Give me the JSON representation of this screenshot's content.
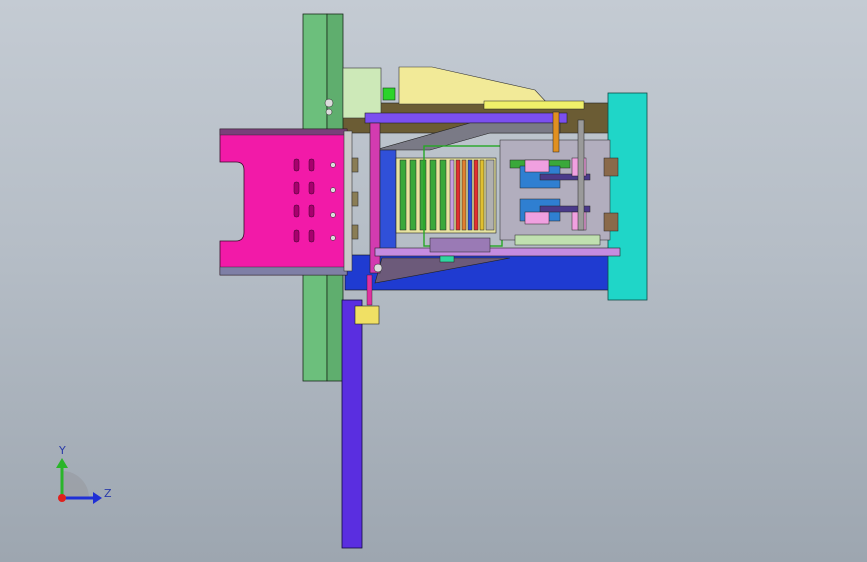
{
  "viewport": {
    "background_top": "#c4cbd3",
    "background_bottom": "#9da6b0"
  },
  "triad": {
    "y_label": "Y",
    "z_label": "Z",
    "x_color": "#e0201c",
    "y_color": "#2ab52a",
    "z_color": "#1f2fd6"
  },
  "model": {
    "name_icon": "mold-assembly-icon",
    "palette": {
      "green_plate": "#6cbf7c",
      "magenta_block": "#f21aa8",
      "purple_rail": "#6a2fe0",
      "cyan_plate": "#1fd6c8",
      "yellow_block": "#f0e668",
      "olive_rod": "#7a6a3a",
      "lavender": "#b79be0",
      "dark_grey": "#5a5a6a"
    }
  }
}
